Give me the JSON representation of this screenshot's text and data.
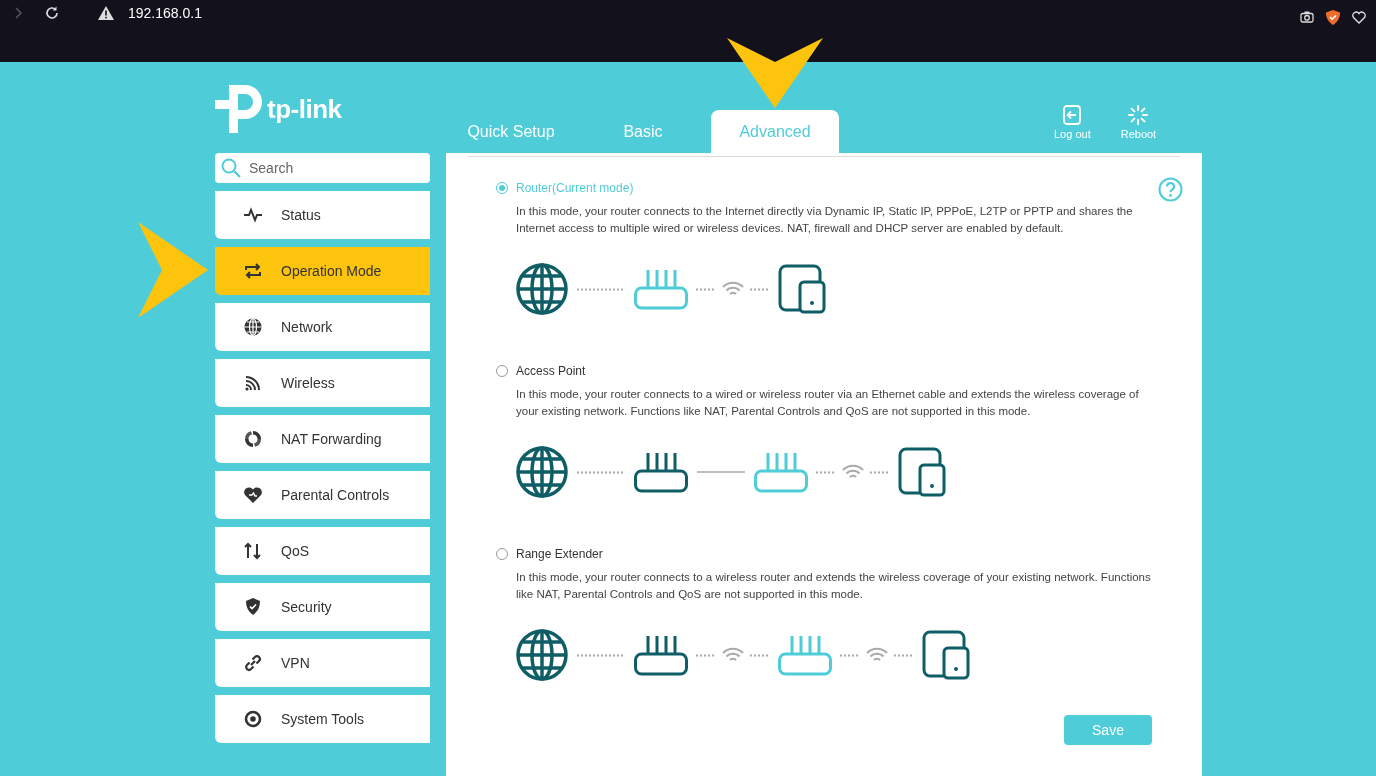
{
  "browser": {
    "address": "192.168.0.1"
  },
  "logo": {
    "text": "tp-link"
  },
  "tabs": [
    {
      "label": "Quick Setup",
      "selected": false
    },
    {
      "label": "Basic",
      "selected": false
    },
    {
      "label": "Advanced",
      "selected": true
    }
  ],
  "header_actions": [
    "Log out",
    "Reboot"
  ],
  "search": {
    "placeholder": "Search"
  },
  "sidebar": {
    "items": [
      {
        "label": "Status",
        "selected": false
      },
      {
        "label": "Operation Mode",
        "selected": true
      },
      {
        "label": "Network",
        "selected": false
      },
      {
        "label": "Wireless",
        "selected": false
      },
      {
        "label": "NAT Forwarding",
        "selected": false
      },
      {
        "label": "Parental Controls",
        "selected": false
      },
      {
        "label": "QoS",
        "selected": false
      },
      {
        "label": "Security",
        "selected": false
      },
      {
        "label": "VPN",
        "selected": false
      },
      {
        "label": "System Tools",
        "selected": false
      }
    ]
  },
  "modes": [
    {
      "label": "Router(Current mode)",
      "selected": true,
      "description": "In this mode, your router connects to the Internet directly via Dynamic IP, Static IP, PPPoE, L2TP or PPTP and shares the Internet access to multiple wired or wireless devices. NAT, firewall and DHCP server are enabled by default.",
      "diagram": [
        {
          "kind": "globe"
        },
        {
          "kind": "dots"
        },
        {
          "kind": "router",
          "highlighted": true
        },
        {
          "kind": "wifi"
        },
        {
          "kind": "device"
        }
      ]
    },
    {
      "label": "Access Point",
      "selected": false,
      "description": "In this mode, your router connects to a wired or wireless router via an Ethernet cable and extends the wireless coverage of your existing network. Functions like NAT, Parental Controls and QoS are not supported in this mode.",
      "diagram": [
        {
          "kind": "globe"
        },
        {
          "kind": "dots"
        },
        {
          "kind": "router",
          "highlighted": false
        },
        {
          "kind": "line"
        },
        {
          "kind": "router",
          "highlighted": true
        },
        {
          "kind": "wifi"
        },
        {
          "kind": "device"
        }
      ]
    },
    {
      "label": "Range Extender",
      "selected": false,
      "description": "In this mode, your router connects to a wireless router and extends the wireless coverage of your existing network. Functions like NAT, Parental Controls and QoS are not supported in this mode.",
      "diagram": [
        {
          "kind": "globe"
        },
        {
          "kind": "dots"
        },
        {
          "kind": "router",
          "highlighted": false
        },
        {
          "kind": "wifi"
        },
        {
          "kind": "router",
          "highlighted": true
        },
        {
          "kind": "wifi"
        },
        {
          "kind": "device"
        }
      ]
    }
  ],
  "save_button": "Save"
}
